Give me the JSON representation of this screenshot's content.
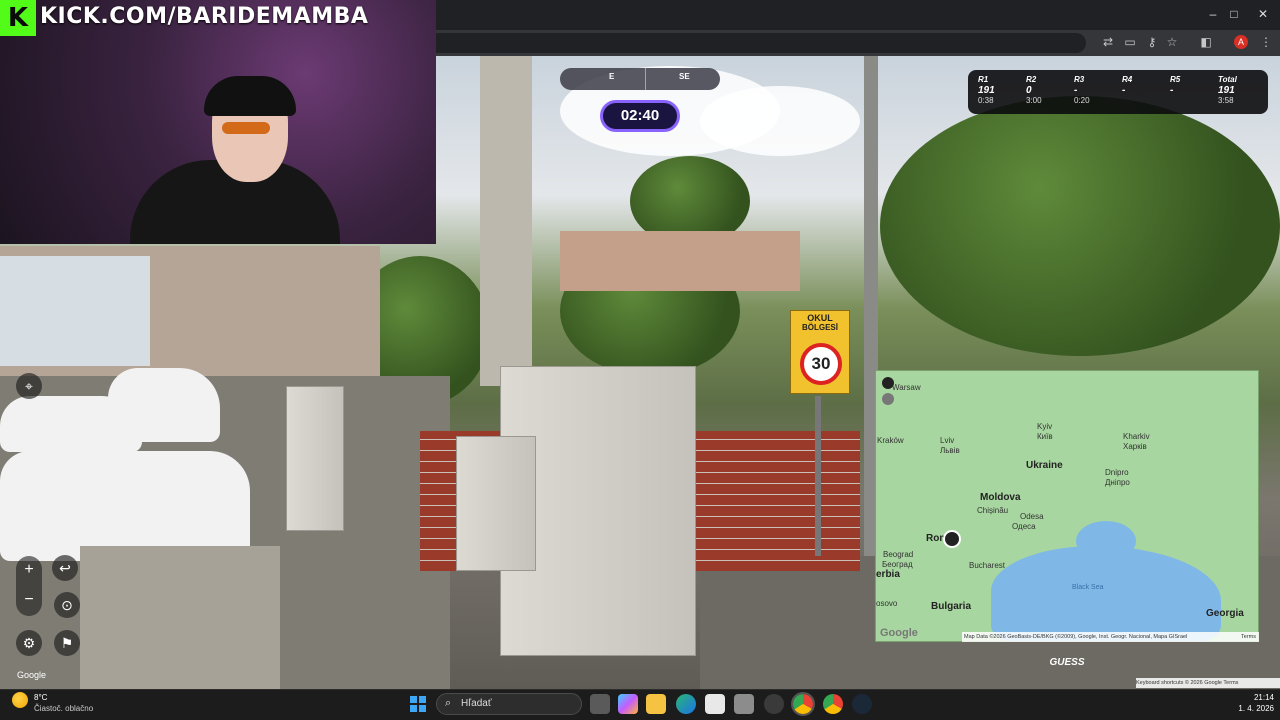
{
  "stream": {
    "logo_letter": "K",
    "url": "KICK.COM/BARIDEMAMBA"
  },
  "compass": {
    "labels": [
      "E",
      "SE"
    ]
  },
  "timer": "02:40",
  "scoreboard": {
    "rounds": [
      {
        "label": "R1",
        "score": "191",
        "time": "0:38"
      },
      {
        "label": "R2",
        "score": "0",
        "time": "3:00"
      },
      {
        "label": "R3",
        "score": "-",
        "time": "0:20"
      },
      {
        "label": "R4",
        "score": "-",
        "time": ""
      },
      {
        "label": "R5",
        "score": "-",
        "time": ""
      }
    ],
    "total": {
      "label": "Total",
      "score": "191",
      "time": "3:58"
    }
  },
  "street_sign": {
    "line1": "OKUL",
    "line2": "BÖLGESİ",
    "speed": "30"
  },
  "map": {
    "labels": {
      "warsaw": "Warsaw",
      "krakow": "Kraków",
      "lviv": "Lviv",
      "lviv_local": "Львів",
      "kyiv": "Kyiv",
      "kyiv_local": "Київ",
      "kharkiv": "Kharkiv",
      "kharkiv_local": "Харків",
      "ukraine": "Ukraine",
      "dnipro": "Dnipro",
      "dnipro_local": "Дніпро",
      "moldova": "Moldova",
      "chisinau": "Chișinău",
      "odesa": "Odesa",
      "odesa_local": "Одеса",
      "romania": "Rom    a",
      "belgrade": "Beograd",
      "belgrade_local": "Београд",
      "bucharest": "Bucharest",
      "serbia": "erbia",
      "kosovo": "osovo",
      "bulgaria": "Bulgaria",
      "black_sea": "Black Sea",
      "georgia": "Georgia"
    },
    "attribution": "Map Data ©2026 GeoBasis-DE/BKG (©2009), Google, Inst. Geogr. Nacional, Mapa GISrael",
    "terms": "Terms",
    "google": "Google"
  },
  "guess_button": "GUESS",
  "shortcuts_bar": "Keyboard shortcuts  © 2026 Google  Terms",
  "sv_google": "Google",
  "controls": {
    "zoom_in": "+",
    "zoom_out": "−",
    "undo": "↩"
  },
  "browser": {
    "avatar_letter": "A",
    "window_controls": [
      "–",
      "□",
      "✕"
    ]
  },
  "taskbar": {
    "weather_temp": "8°C",
    "weather_desc": "Čiastoč. oblačno",
    "search_placeholder": "Hľadať",
    "time": "21:14",
    "date": "1. 4. 2026"
  },
  "colors": {
    "kick_green": "#53fc18",
    "timer_border": "#8a63ff",
    "timer_bg": "#1a1540"
  }
}
